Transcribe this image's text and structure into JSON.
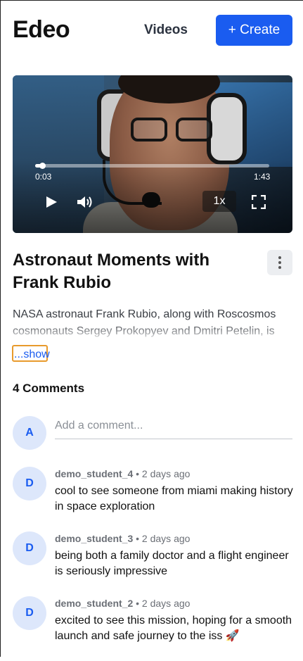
{
  "header": {
    "logo": "Edeo",
    "nav_videos": "Videos",
    "create_label": "+ Create"
  },
  "player": {
    "current_time": "0:03",
    "duration": "1:43",
    "progress_fraction": 0.03,
    "speed": "1x"
  },
  "video": {
    "title": "Astronaut Moments with Frank Rubio",
    "description": "NASA astronaut Frank Rubio, along with Roscosmos cosmonauts Sergey Prokopyev and Dmitri Petelin, is",
    "show_more": "...show"
  },
  "comments": {
    "count_label": "4 Comments",
    "input_placeholder": "Add a comment...",
    "current_user_initial": "A",
    "items": [
      {
        "initial": "D",
        "author": "demo_student_4",
        "time": "• 2 days ago",
        "text": "cool to see someone from miami making history in space exploration"
      },
      {
        "initial": "D",
        "author": "demo_student_3",
        "time": "• 2 days ago",
        "text": "being both a family doctor and a flight engineer is seriously impressive"
      },
      {
        "initial": "D",
        "author": "demo_student_2",
        "time": "• 2 days ago",
        "text": "excited to see this mission, hoping for a smooth launch and safe journey to the iss 🚀"
      }
    ]
  },
  "colors": {
    "accent": "#1a5cf0",
    "avatar_bg": "#dde7fb",
    "focus_ring": "#e89a2c"
  }
}
